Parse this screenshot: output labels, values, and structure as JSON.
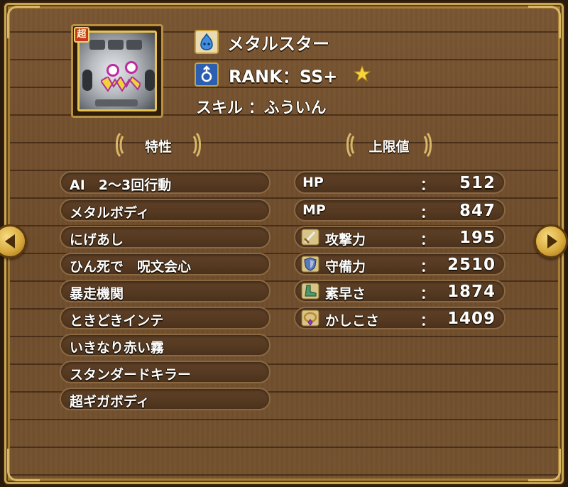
{
  "monster": {
    "name": "メタルスター",
    "rank_label": "RANK：SS+",
    "skill_label": "スキル ：ふういん",
    "rarity_badge": "超"
  },
  "headers": {
    "traits": "特性",
    "stats": "上限値"
  },
  "traits": [
    "AI　2〜3回行動",
    "メタルボディ",
    "にげあし",
    "ひん死で　呪文会心",
    "暴走機関",
    "ときどきインテ",
    "いきなり赤い霧",
    "スタンダードキラー",
    "超ギガボディ"
  ],
  "stats": [
    {
      "name": "HP",
      "colon": "：",
      "value": "512",
      "icon": "none"
    },
    {
      "name": "MP",
      "colon": "：",
      "value": "847",
      "icon": "none"
    },
    {
      "name": "攻撃力",
      "colon": "：",
      "value": "195",
      "icon": "sword-icon"
    },
    {
      "name": "守備力",
      "colon": "：",
      "value": "2510",
      "icon": "shield-icon"
    },
    {
      "name": "素早さ",
      "colon": "：",
      "value": "1874",
      "icon": "boots-icon"
    },
    {
      "name": "かしこさ",
      "colon": "：",
      "value": "1409",
      "icon": "circlet-icon"
    }
  ],
  "colors": {
    "wood": "#6e4c2b",
    "gold_frame": "#c9a653",
    "row_fill": "#553921",
    "text": "#ffffff"
  }
}
